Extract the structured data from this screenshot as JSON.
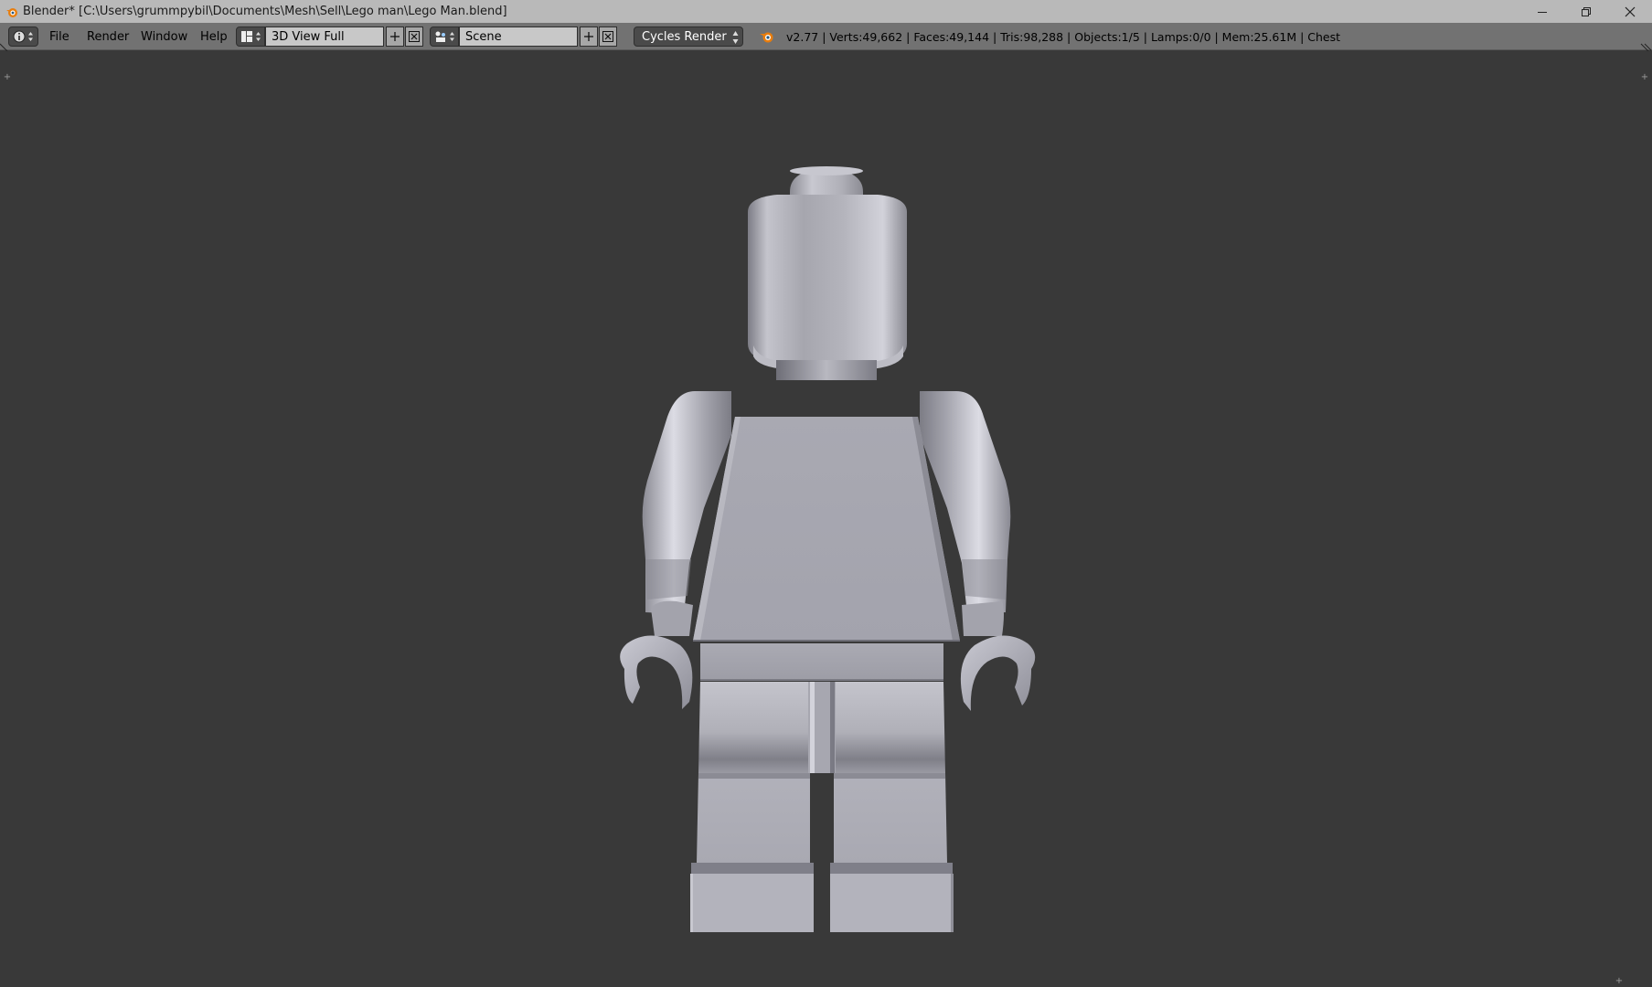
{
  "window": {
    "title": "Blender* [C:\\Users\\grummpybil\\Documents\\Mesh\\Sell\\Lego man\\Lego Man.blend]",
    "controls": {
      "minimize_icon": "minimize-icon",
      "restore_icon": "restore-icon",
      "close_icon": "close-icon"
    }
  },
  "header": {
    "editor_type_icon": "info-icon",
    "menus": [
      "File",
      "Render",
      "Window",
      "Help"
    ],
    "screen_layout": {
      "icon": "layout-icon",
      "value": "3D View Full"
    },
    "scene": {
      "icon": "scene-icon",
      "value": "Scene"
    },
    "render_engine": "Cycles Render",
    "stats": "v2.77 | Verts:49,662 | Faces:49,144 | Tris:98,288 | Objects:1/5 | Lamps:0/0 | Mem:25.61M | Chest"
  },
  "viewport": {
    "object": "lego-minifigure",
    "background_color": "#393939",
    "material_color": "#a9a9b4"
  },
  "colors": {
    "titlebar": "#b9b9b9",
    "header": "#727272",
    "field": "#c8c8c8",
    "accent": "#e87d0d"
  }
}
